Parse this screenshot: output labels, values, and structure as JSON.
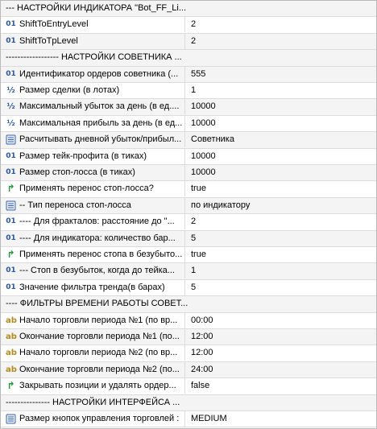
{
  "rows": [
    {
      "kind": "section",
      "name": "---  НАСТРОЙКИ ИНДИКАТОРА \"Bot_FF_Li..."
    },
    {
      "kind": "param",
      "icon": "int",
      "name": "ShiftToEntryLevel",
      "value": "2"
    },
    {
      "kind": "param",
      "icon": "int",
      "name": "ShiftToTpLevel",
      "value": "2"
    },
    {
      "kind": "section",
      "name": "------------------   НАСТРОЙКИ СОВЕТНИКА ..."
    },
    {
      "kind": "param",
      "icon": "int",
      "name": "Идентификатор ордеров советника (...",
      "value": "555"
    },
    {
      "kind": "param",
      "icon": "double",
      "name": "Размер сделки (в лотах)",
      "value": "1"
    },
    {
      "kind": "param",
      "icon": "double",
      "name": "Максимальный убыток за день (в ед....",
      "value": "10000"
    },
    {
      "kind": "param",
      "icon": "double",
      "name": "Максимальная прибыль за день (в ед...",
      "value": "10000"
    },
    {
      "kind": "param",
      "icon": "enum",
      "name": "Расчитывать дневной убыток/прибыл...",
      "value": "Советника"
    },
    {
      "kind": "param",
      "icon": "int",
      "name": "Размер тейк-профита (в тиках)",
      "value": "10000"
    },
    {
      "kind": "param",
      "icon": "int",
      "name": "Размер стоп-лосса (в тиках)",
      "value": "10000"
    },
    {
      "kind": "param",
      "icon": "bool",
      "name": "Применять перенос стоп-лосса?",
      "value": "true"
    },
    {
      "kind": "param",
      "icon": "enum",
      "name": "-- Тип переноса стоп-лосса",
      "value": "по индикатору"
    },
    {
      "kind": "param",
      "icon": "int",
      "name": "---- Для фракталов: расстояние до \"...",
      "value": "2"
    },
    {
      "kind": "param",
      "icon": "int",
      "name": "---- Для индикатора: количество бар...",
      "value": "5"
    },
    {
      "kind": "param",
      "icon": "bool",
      "name": "Применять перенос стопа в безубыто...",
      "value": "true"
    },
    {
      "kind": "param",
      "icon": "int",
      "name": "--- Стоп в безубыток, когда до тейка...",
      "value": "1"
    },
    {
      "kind": "param",
      "icon": "int",
      "name": "Значение фильтра тренда(в барах)",
      "value": "5"
    },
    {
      "kind": "section",
      "name": "----   ФИЛЬТРЫ ВРЕМЕНИ РАБОТЫ СОВЕТ..."
    },
    {
      "kind": "param",
      "icon": "string",
      "name": "Начало торговли периода №1 (по вр...",
      "value": "00:00"
    },
    {
      "kind": "param",
      "icon": "string",
      "name": "Окончание торговли периода №1 (по...",
      "value": "12:00"
    },
    {
      "kind": "param",
      "icon": "string",
      "name": "Начало торговли периода №2 (по вр...",
      "value": "12:00"
    },
    {
      "kind": "param",
      "icon": "string",
      "name": "Окончание торговли периода №2 (по...",
      "value": "24:00"
    },
    {
      "kind": "param",
      "icon": "bool",
      "name": "Закрывать позиции и удалять ордер...",
      "value": "false"
    },
    {
      "kind": "section",
      "name": "---------------   НАСТРОЙКИ ИНТЕРФЕЙСА  ..."
    },
    {
      "kind": "param",
      "icon": "enum",
      "name": "Размер кнопок управления торговлей :",
      "value": "MEDIUM"
    }
  ],
  "icons": {
    "int": {
      "glyph": "01",
      "name": "integer-icon"
    },
    "double": {
      "glyph": "½",
      "name": "double-icon"
    },
    "enum": {
      "glyph": "",
      "name": "enum-list-icon"
    },
    "bool": {
      "glyph": "↱",
      "name": "bool-arrow-icon"
    },
    "string": {
      "glyph": "ab",
      "name": "string-icon"
    }
  },
  "colors": {
    "grid_line": "#dcdcdc",
    "alt_row": "#f4f4f4",
    "int_icon": "#2a55a8",
    "bool_icon": "#1d9a3a",
    "string_icon": "#b58a1a"
  }
}
